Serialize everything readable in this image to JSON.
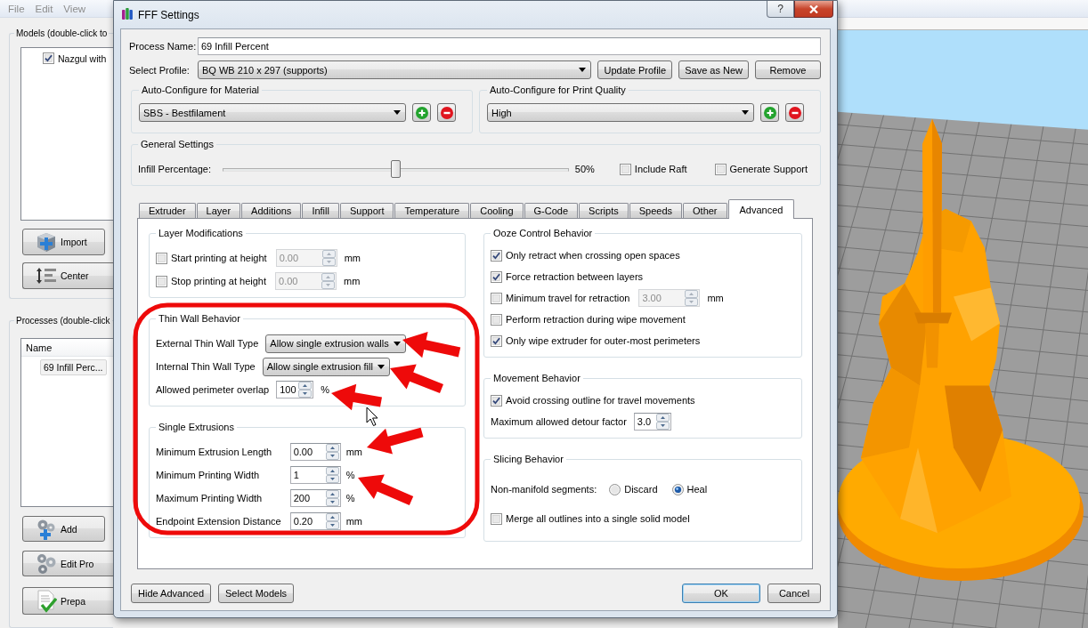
{
  "app": {
    "menu": [
      "File",
      "Edit",
      "View"
    ],
    "models": {
      "title": "Models (double-click to",
      "items": [
        {
          "label": "Nazgul with",
          "checked": true
        }
      ],
      "buttons": [
        {
          "label": "Import",
          "kind": "import"
        },
        {
          "label": "Center",
          "kind": "center"
        }
      ]
    },
    "processes": {
      "title": "Processes (double-click",
      "columns": [
        "Name"
      ],
      "rows": [
        {
          "name": "69 Infill Perc...",
          "selected": true
        }
      ],
      "buttons": [
        {
          "label": "Add",
          "kind": "add"
        },
        {
          "label": "Edit Pro",
          "kind": "edit"
        },
        {
          "label": "Prepa",
          "kind": "prepare"
        }
      ]
    }
  },
  "dialog": {
    "title": "FFF Settings",
    "help_button": "?",
    "process_name": {
      "label": "Process Name:",
      "value": "69 Infill Percent"
    },
    "profile": {
      "label": "Select Profile:",
      "value": "BQ WB 210 x 297 (supports)",
      "buttons": [
        "Update Profile",
        "Save as New",
        "Remove"
      ]
    },
    "auto_configure": [
      {
        "title": "Auto-Configure for Material",
        "value": "SBS - Bestfilament"
      },
      {
        "title": "Auto-Configure for Print Quality",
        "value": "High"
      }
    ],
    "general_settings": {
      "title": "General Settings",
      "label": "Infill Percentage:",
      "level": 0.5,
      "reading": "50%",
      "checkboxes": [
        {
          "label": "Include Raft",
          "checked": false
        },
        {
          "label": "Generate Support",
          "checked": false
        }
      ]
    },
    "tabs": [
      {
        "label": "Extruder",
        "selected": false
      },
      {
        "label": "Layer",
        "selected": false
      },
      {
        "label": "Additions",
        "selected": false
      },
      {
        "label": "Infill",
        "selected": false
      },
      {
        "label": "Support",
        "selected": false
      },
      {
        "label": "Temperature",
        "selected": false
      },
      {
        "label": "Cooling",
        "selected": false
      },
      {
        "label": "G-Code",
        "selected": false
      },
      {
        "label": "Scripts",
        "selected": false
      },
      {
        "label": "Speeds",
        "selected": false
      },
      {
        "label": "Other",
        "selected": false
      },
      {
        "label": "Advanced",
        "selected": true
      }
    ],
    "advanced": {
      "left_column": {
        "groups": [
          {
            "title": "Layer Modifications",
            "rows": [
              {
                "kind": "check_spin",
                "label": "Start printing at height",
                "checked": false,
                "value": "0.00",
                "unit": "mm",
                "disabled": true
              },
              {
                "kind": "check_spin",
                "label": "Stop printing at height",
                "checked": false,
                "value": "0.00",
                "unit": "mm",
                "disabled": true
              }
            ]
          },
          {
            "title": "Thin Wall Behavior",
            "rows": [
              {
                "kind": "select",
                "label": "External Thin Wall Type",
                "value": "Allow single extrusion walls",
                "disabled": false
              },
              {
                "kind": "select",
                "label": "Internal Thin Wall Type",
                "value": "Allow single extrusion fill",
                "disabled": false
              },
              {
                "kind": "spin",
                "label": "Allowed perimeter overlap",
                "value": "100",
                "unit": "%",
                "disabled": false
              }
            ]
          },
          {
            "title": "Single Extrusions",
            "rows": [
              {
                "kind": "spin",
                "label": "Minimum Extrusion Length",
                "value": "0.00",
                "unit": "mm",
                "disabled": false
              },
              {
                "kind": "spin",
                "label": "Minimum Printing Width",
                "value": "1",
                "unit": "%",
                "disabled": false
              },
              {
                "kind": "spin",
                "label": "Maximum Printing Width",
                "value": "200",
                "unit": "%",
                "disabled": false
              },
              {
                "kind": "spin",
                "label": "Endpoint Extension Distance",
                "value": "0.20",
                "unit": "mm",
                "disabled": false
              }
            ]
          }
        ]
      },
      "right_column": {
        "groups": [
          {
            "title": "Ooze Control Behavior",
            "rows": [
              {
                "kind": "check",
                "label": "Only retract when crossing open spaces",
                "checked": true,
                "disabled": false
              },
              {
                "kind": "check",
                "label": "Force retraction between layers",
                "checked": true,
                "disabled": false
              },
              {
                "kind": "check_spin",
                "label": "Minimum travel for retraction",
                "checked": false,
                "value": "3.00",
                "unit": "mm",
                "disabled": true
              },
              {
                "kind": "check",
                "label": "Perform retraction during wipe movement",
                "checked": false,
                "disabled": false
              },
              {
                "kind": "check",
                "label": "Only wipe extruder for outer-most perimeters",
                "checked": true,
                "disabled": false
              }
            ]
          },
          {
            "title": "Movement Behavior",
            "rows": [
              {
                "kind": "check",
                "label": "Avoid crossing outline for travel movements",
                "checked": true,
                "disabled": false
              },
              {
                "kind": "spin",
                "label": "Maximum allowed detour factor",
                "value": "3.0",
                "disabled": false
              }
            ]
          },
          {
            "title": "Slicing Behavior",
            "rows": [
              {
                "kind": "radio",
                "label": "Non-manifold segments:",
                "disabled": false,
                "options": [
                  {
                    "label": "Discard",
                    "selected": false
                  },
                  {
                    "label": "Heal",
                    "selected": true
                  }
                ]
              },
              {
                "kind": "check",
                "label": "Merge all outlines into a single solid model",
                "checked": false,
                "disabled": false
              }
            ]
          }
        ]
      }
    },
    "left_buttons": [
      {
        "label": "Hide Advanced",
        "default": false
      },
      {
        "label": "Select Models",
        "default": false
      }
    ],
    "right_buttons": [
      {
        "label": "OK",
        "default": true
      },
      {
        "label": "Cancel",
        "default": false
      }
    ]
  }
}
